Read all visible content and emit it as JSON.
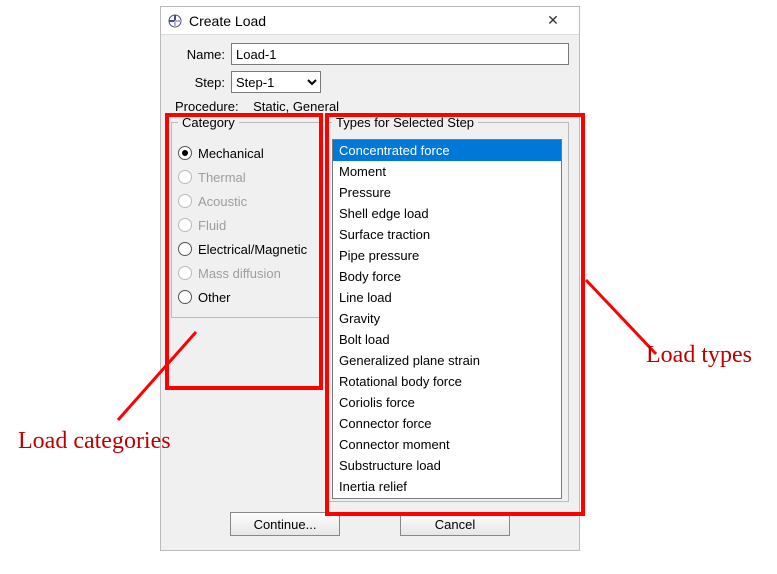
{
  "dialog": {
    "title": "Create Load",
    "name_label": "Name:",
    "name_value": "Load-1",
    "step_label": "Step:",
    "step_value": "Step-1",
    "procedure_label": "Procedure:",
    "procedure_value": "Static, General"
  },
  "category": {
    "group_label": "Category",
    "items": [
      {
        "label": "Mechanical",
        "selected": true,
        "enabled": true
      },
      {
        "label": "Thermal",
        "selected": false,
        "enabled": false
      },
      {
        "label": "Acoustic",
        "selected": false,
        "enabled": false
      },
      {
        "label": "Fluid",
        "selected": false,
        "enabled": false
      },
      {
        "label": "Electrical/Magnetic",
        "selected": false,
        "enabled": true
      },
      {
        "label": "Mass diffusion",
        "selected": false,
        "enabled": false
      },
      {
        "label": "Other",
        "selected": false,
        "enabled": true
      }
    ]
  },
  "types": {
    "group_label": "Types for Selected Step",
    "items": [
      {
        "label": "Concentrated force",
        "selected": true
      },
      {
        "label": "Moment",
        "selected": false
      },
      {
        "label": "Pressure",
        "selected": false
      },
      {
        "label": "Shell edge load",
        "selected": false
      },
      {
        "label": "Surface traction",
        "selected": false
      },
      {
        "label": "Pipe pressure",
        "selected": false
      },
      {
        "label": "Body force",
        "selected": false
      },
      {
        "label": "Line load",
        "selected": false
      },
      {
        "label": "Gravity",
        "selected": false
      },
      {
        "label": "Bolt load",
        "selected": false
      },
      {
        "label": "Generalized plane strain",
        "selected": false
      },
      {
        "label": "Rotational body force",
        "selected": false
      },
      {
        "label": "Coriolis force",
        "selected": false
      },
      {
        "label": "Connector force",
        "selected": false
      },
      {
        "label": "Connector moment",
        "selected": false
      },
      {
        "label": "Substructure load",
        "selected": false
      },
      {
        "label": "Inertia relief",
        "selected": false
      }
    ]
  },
  "buttons": {
    "continue": "Continue...",
    "cancel": "Cancel"
  },
  "annotations": {
    "categories_label": "Load categories",
    "types_label": "Load types"
  }
}
